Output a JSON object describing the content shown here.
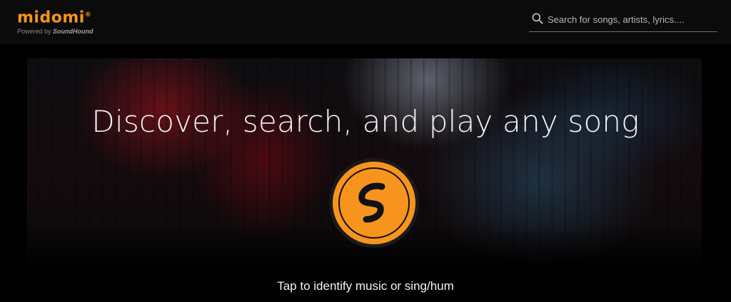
{
  "header": {
    "logo_text": "midomi",
    "logo_mark": "®",
    "powered_prefix": "Powered by",
    "powered_brand": "SoundHound"
  },
  "search": {
    "placeholder": "Search for songs, artists, lyrics....",
    "value": "",
    "icon": "search-icon"
  },
  "hero": {
    "headline": "Discover, search, and play any song",
    "button_icon": "soundhound-logo-icon",
    "tagline": "Tap to identify music or sing/hum"
  },
  "colors": {
    "brand_orange": "#f7941d",
    "background": "#000000",
    "text": "#ffffff"
  }
}
